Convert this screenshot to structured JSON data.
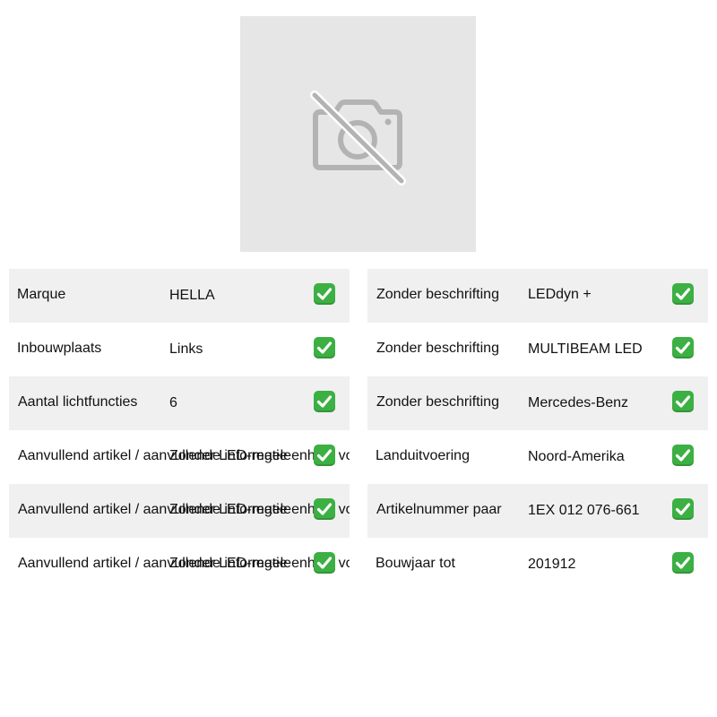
{
  "image": {
    "icon": "camera-off-icon",
    "background": "#e6e6e6",
    "icon_color": "#b3b3b3"
  },
  "check_color": "#3cb043",
  "table_left": [
    {
      "label": "Marque",
      "value": "HELLA",
      "shaded": true
    },
    {
      "label": "Inbouwplaats",
      "value": "Links",
      "shaded": false
    },
    {
      "label": "Aantal lichtfuncties",
      "value": "6",
      "shaded": true
    },
    {
      "label": "Aanvullend artikel / aanvullende informatie",
      "value": "Zonder LED-regeleenheid voor",
      "shaded": false
    },
    {
      "label": "Aanvullend artikel / aanvullende informatie",
      "value": "Zonder LED-regeleenheid voor",
      "shaded": true
    },
    {
      "label": "Aanvullend artikel / aanvullende informatie",
      "value": "Zonder LED-regeleenheid voor",
      "shaded": false
    }
  ],
  "table_right": [
    {
      "label": "Zonder beschrifting",
      "value": "LEDdyn +",
      "shaded": true
    },
    {
      "label": "Zonder beschrifting",
      "value": "MULTIBEAM LED",
      "shaded": false
    },
    {
      "label": "Zonder beschrifting",
      "value": "Mercedes-Benz",
      "shaded": true
    },
    {
      "label": "Landuitvoering",
      "value": "Noord-Amerika",
      "shaded": false
    },
    {
      "label": "Artikelnummer paar",
      "value": "1EX 012 076-661",
      "shaded": true
    },
    {
      "label": "Bouwjaar tot",
      "value": "201912",
      "shaded": false
    }
  ]
}
